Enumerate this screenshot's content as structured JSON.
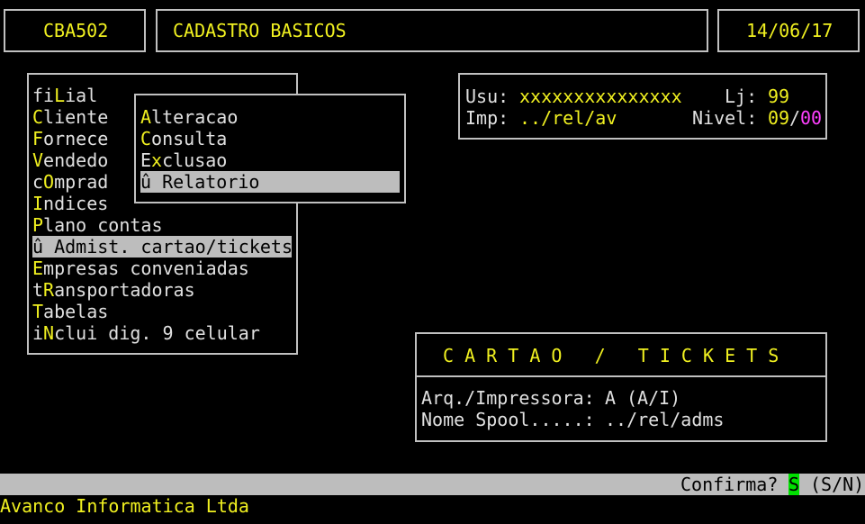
{
  "header": {
    "program_code": "CBA502",
    "title": "CADASTRO BASICOS",
    "date": "14/06/17"
  },
  "main_menu": {
    "items": [
      {
        "pre": "fi",
        "hot": "L",
        "post": "ial"
      },
      {
        "pre": "",
        "hot": "C",
        "post": "liente"
      },
      {
        "pre": "",
        "hot": "F",
        "post": "ornece"
      },
      {
        "pre": "",
        "hot": "V",
        "post": "endedo"
      },
      {
        "pre": "c",
        "hot": "O",
        "post": "mprad"
      },
      {
        "pre": "",
        "hot": "I",
        "post": "ndices"
      },
      {
        "pre": "",
        "hot": "P",
        "post": "lano contas"
      },
      {
        "pre": "û ",
        "hot": "",
        "post": "Admist. cartao/tickets",
        "selected": true
      },
      {
        "pre": "",
        "hot": "E",
        "post": "mpresas conveniadas"
      },
      {
        "pre": "t",
        "hot": "R",
        "post": "ansportadoras"
      },
      {
        "pre": "",
        "hot": "T",
        "post": "abelas"
      },
      {
        "pre": "i",
        "hot": "N",
        "post": "clui dig. 9 celular"
      }
    ]
  },
  "sub_menu": {
    "items": [
      {
        "pre": "",
        "hot": "A",
        "post": "lteracao"
      },
      {
        "pre": "",
        "hot": "C",
        "post": "onsulta"
      },
      {
        "pre": "E",
        "hot": "x",
        "post": "clusao"
      },
      {
        "pre": "û ",
        "hot": "",
        "post": "Relatorio",
        "selected": true
      }
    ]
  },
  "user_info": {
    "usu_label": "Usu:",
    "usu_value": "xxxxxxxxxxxxxxx",
    "lj_label": "Lj:",
    "lj_value": "99",
    "imp_label": "Imp:",
    "imp_value": "../rel/av",
    "nivel_label": "Nivel:",
    "nivel_value": "09",
    "nivel_sep": "/",
    "nivel_value2": "00"
  },
  "report_panel": {
    "title": "C A R T A O   /   T I C K E T S",
    "arq_label": "Arq./Impressora:",
    "arq_value": "A",
    "arq_hint": "(A/I)",
    "spool_label": "Nome Spool.....:",
    "spool_value": "../rel/adms"
  },
  "status_bar": {
    "confirm_label": "Confirma?",
    "confirm_value": "S",
    "confirm_hint": "(S/N)"
  },
  "footer": {
    "company": "Avanco Informatica Ltda"
  },
  "colors": {
    "background": "#000000",
    "highlight": "#f0f020",
    "selection": "#bdbdbd",
    "magenta": "#ff40ff",
    "confirm_bg": "#00e000"
  }
}
